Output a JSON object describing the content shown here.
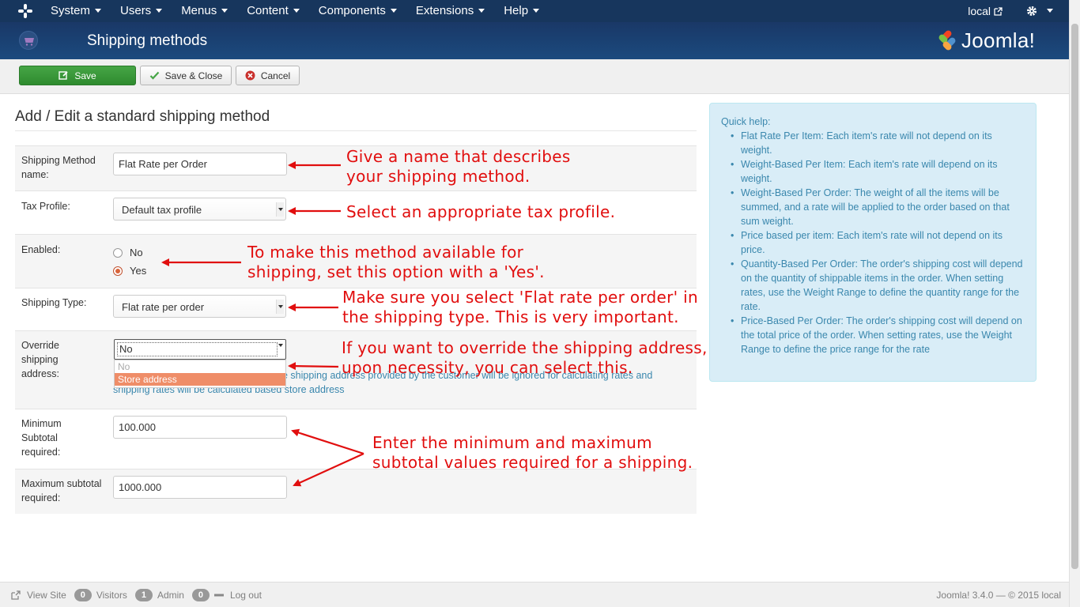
{
  "navbar": {
    "menu": [
      "System",
      "Users",
      "Menus",
      "Content",
      "Components",
      "Extensions",
      "Help"
    ],
    "user_site": "local"
  },
  "header": {
    "title": "Shipping methods",
    "brand": "Joomla!"
  },
  "toolbar": {
    "save": "Save",
    "save_close": "Save & Close",
    "cancel": "Cancel"
  },
  "form": {
    "heading": "Add / Edit a standard shipping method",
    "name": {
      "label": "Shipping Method name:",
      "value": "Flat Rate per Order"
    },
    "tax_profile": {
      "label": "Tax Profile:",
      "value": "Default tax profile"
    },
    "enabled": {
      "label": "Enabled:",
      "options": [
        "No",
        "Yes"
      ],
      "selected": "Yes"
    },
    "shipping_type": {
      "label": "Shipping Type:",
      "value": "Flat rate per order"
    },
    "override": {
      "label": "Override shipping address:",
      "value": "No",
      "options": [
        "No",
        "Store address"
      ],
      "help": "If you set this to Store address, then the shipping address provided by the customer will be ignored for calculating rates and shipping rates will be calculated based store address"
    },
    "min_subtotal": {
      "label": "Minimum Subtotal required:",
      "value": "100.000"
    },
    "max_subtotal": {
      "label": "Maximum subtotal required:",
      "value": "1000.000"
    }
  },
  "quick_help": {
    "title": "Quick help:",
    "items": [
      "Flat Rate Per Item: Each item's rate will not depend on its weight.",
      "Weight-Based Per Item: Each item's rate will depend on its weight.",
      "Weight-Based Per Order: The weight of all the items will be summed, and a rate will be applied to the order based on that sum weight.",
      "Price based per item: Each item's rate will not depend on its price.",
      "Quantity-Based Per Order: The order's shipping cost will depend on the quantity of shippable items in the order. When setting rates, use the Weight Range to define the quantity range for the rate.",
      "Price-Based Per Order: The order's shipping cost will depend on the total price of the order. When setting rates, use the Weight Range to define the price range for the rate"
    ]
  },
  "annotations": {
    "name": [
      "Give a name that describes",
      "your shipping method."
    ],
    "tax": "Select an appropriate tax profile.",
    "enabled": [
      "To make this method available for",
      "shipping, set this option with a 'Yes'."
    ],
    "type": [
      "Make sure you select 'Flat rate per order' in",
      "the shipping type. This is very important."
    ],
    "override": [
      "If you want to override the shipping address,",
      "upon necessity, you can select this."
    ],
    "subtotal": [
      "Enter the minimum and maximum",
      "subtotal values required for a shipping."
    ]
  },
  "statusbar": {
    "view_site": "View Site",
    "visitors_count": "0",
    "visitors": "Visitors",
    "admin_count": "1",
    "admin": "Admin",
    "logout_count": "0",
    "logout": "Log out",
    "version": "Joomla! 3.4.0 — © 2015 local"
  },
  "colors": {
    "navbar": "#17365d",
    "save_button": "#3d9b3d",
    "annotation": "#e10e0e",
    "help_text": "#3a87ad"
  }
}
